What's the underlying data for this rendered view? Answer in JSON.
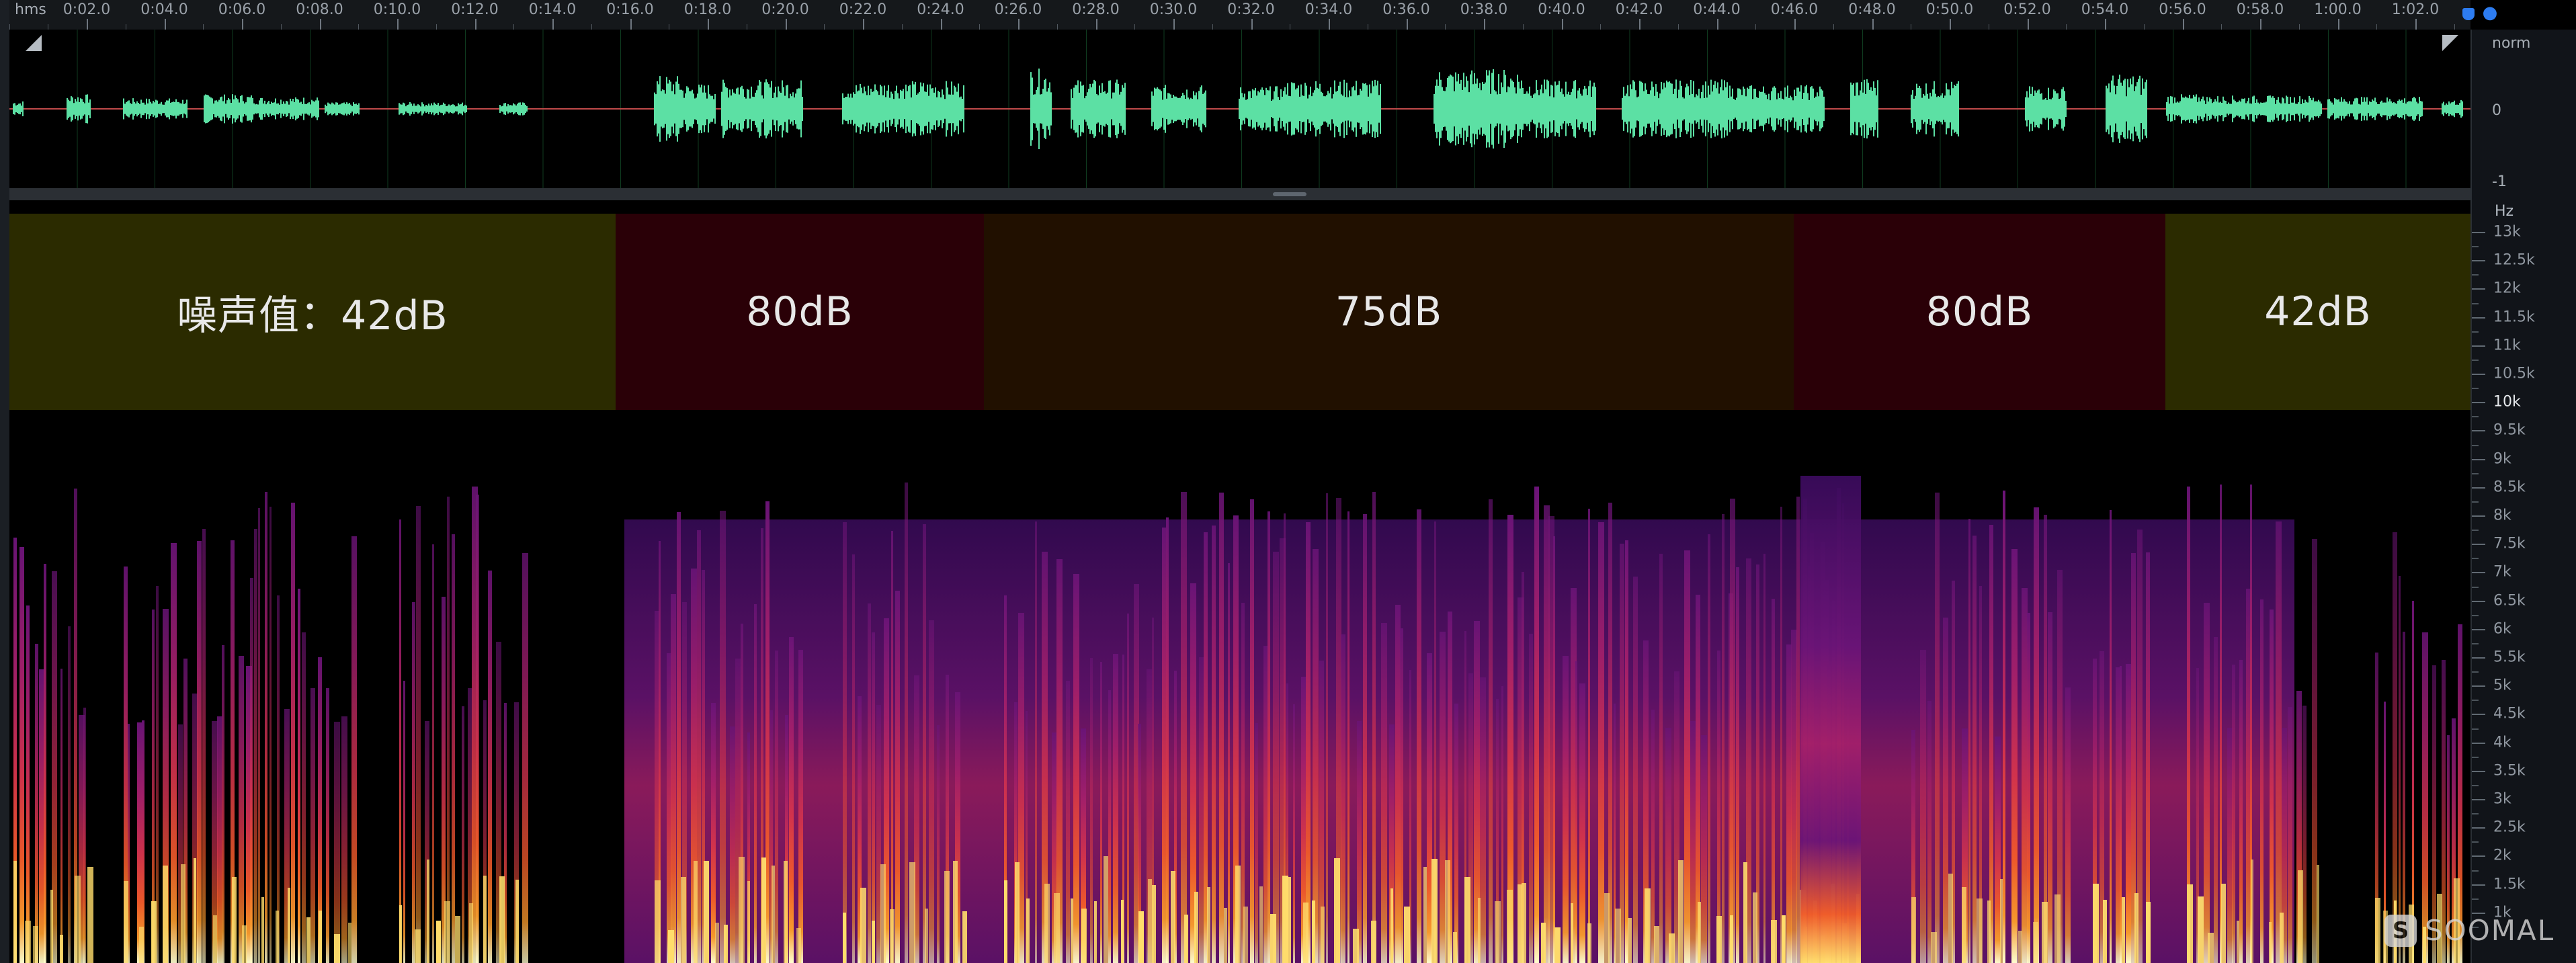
{
  "timeline": {
    "unit_label": "hms",
    "tick_labels": [
      "0:02.0",
      "0:04.0",
      "0:06.0",
      "0:08.0",
      "0:10.0",
      "0:12.0",
      "0:14.0",
      "0:16.0",
      "0:18.0",
      "0:20.0",
      "0:22.0",
      "0:24.0",
      "0:26.0",
      "0:28.0",
      "0:30.0",
      "0:32.0",
      "0:34.0",
      "0:36.0",
      "0:38.0",
      "0:40.0",
      "0:42.0",
      "0:44.0",
      "0:46.0",
      "0:48.0",
      "0:50.0",
      "0:52.0",
      "0:54.0",
      "0:56.0",
      "0:58.0",
      "1:00.0",
      "1:02.0"
    ]
  },
  "waveform": {
    "scale_labels": [
      "norm",
      "0",
      "-1"
    ],
    "color": "#5ce0a4"
  },
  "spectrogram": {
    "unit": "Hz",
    "freq_labels": [
      "13k",
      "12.5k",
      "12k",
      "11.5k",
      "11k",
      "10.5k",
      "10k",
      "9.5k",
      "9k",
      "8.5k",
      "8k",
      "7.5k",
      "7k",
      "6.5k",
      "6k",
      "5.5k",
      "5k",
      "4.5k",
      "4k",
      "3.5k",
      "3k",
      "2.5k",
      "2k",
      "1.5k",
      "1k"
    ],
    "palette": [
      "#1a0730",
      "#3a0b5c",
      "#6a1477",
      "#a21f6a",
      "#d2334c",
      "#ef5a2a",
      "#f79a2c",
      "#ffdd6b",
      "#ffffd0"
    ]
  },
  "noise_levels": [
    {
      "label": "噪声值：42dB",
      "color": "#2b2b00"
    },
    {
      "label": "80dB",
      "color": "#2a0007"
    },
    {
      "label": "75dB",
      "color": "#211000"
    },
    {
      "label": "80dB",
      "color": "#2a0007"
    },
    {
      "label": "42dB",
      "color": "#2b2b00"
    }
  ],
  "watermark": {
    "logo": "S",
    "text": "SOOMAL"
  }
}
